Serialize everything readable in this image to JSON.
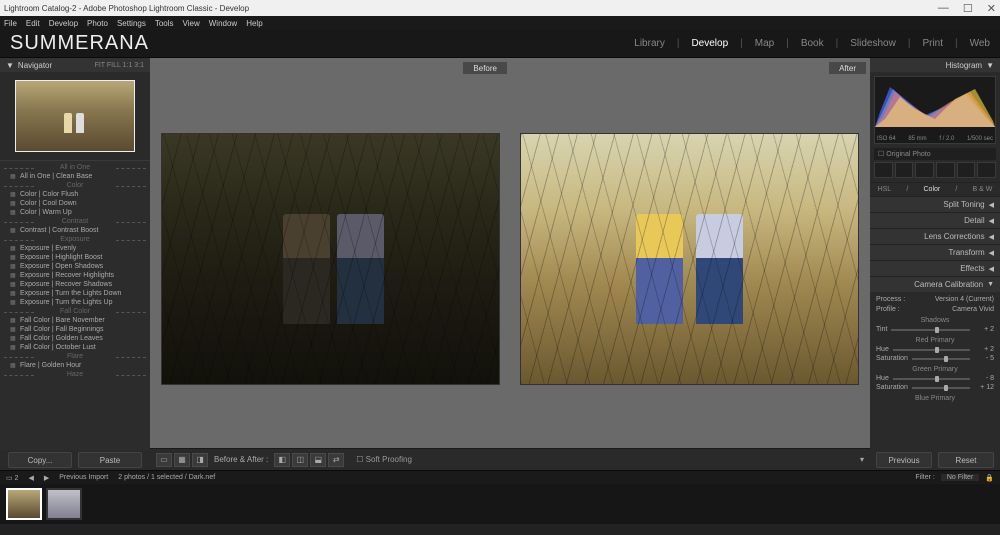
{
  "window": {
    "title": "Lightroom Catalog-2 - Adobe Photoshop Lightroom Classic - Develop"
  },
  "menu": [
    "File",
    "Edit",
    "Develop",
    "Photo",
    "Settings",
    "Tools",
    "View",
    "Window",
    "Help"
  ],
  "brand": "SUMMERANA",
  "modules": [
    "Library",
    "Develop",
    "Map",
    "Book",
    "Slideshow",
    "Print",
    "Web"
  ],
  "active_module": "Develop",
  "navigator": {
    "title": "Navigator",
    "opts": "FIT  FILL  1:1  3:1"
  },
  "presets": [
    {
      "type": "div",
      "label": "All in One"
    },
    {
      "type": "item",
      "label": "All in One | Clean Base"
    },
    {
      "type": "div",
      "label": "Color"
    },
    {
      "type": "item",
      "label": "Color | Color Flush"
    },
    {
      "type": "item",
      "label": "Color | Cool Down"
    },
    {
      "type": "item",
      "label": "Color | Warm Up"
    },
    {
      "type": "div",
      "label": "Contrast"
    },
    {
      "type": "item",
      "label": "Contrast | Contrast Boost"
    },
    {
      "type": "div",
      "label": "Exposure"
    },
    {
      "type": "item",
      "label": "Exposure | Evenly"
    },
    {
      "type": "item",
      "label": "Exposure | Highlight Boost"
    },
    {
      "type": "item",
      "label": "Exposure | Open Shadows"
    },
    {
      "type": "item",
      "label": "Exposure | Recover Highlights"
    },
    {
      "type": "item",
      "label": "Exposure | Recover Shadows"
    },
    {
      "type": "item",
      "label": "Exposure | Turn the Lights Down"
    },
    {
      "type": "item",
      "label": "Exposure | Turn the Lights Up"
    },
    {
      "type": "div",
      "label": "Fall Color"
    },
    {
      "type": "item",
      "label": "Fall Color | Bare November"
    },
    {
      "type": "item",
      "label": "Fall Color | Fall Beginnings"
    },
    {
      "type": "item",
      "label": "Fall Color | Golden Leaves"
    },
    {
      "type": "item",
      "label": "Fall Color | October Lust"
    },
    {
      "type": "div",
      "label": "Flare"
    },
    {
      "type": "item",
      "label": "Flare | Golden Hour"
    },
    {
      "type": "div",
      "label": "Haze"
    }
  ],
  "left_buttons": {
    "copy": "Copy...",
    "paste": "Paste"
  },
  "compare": {
    "before": "Before",
    "after": "After"
  },
  "toolbar": {
    "balabel": "Before & After :",
    "soft": "Soft Proofing"
  },
  "histogram": {
    "title": "Histogram",
    "meta": {
      "iso": "ISO 64",
      "focal": "85 mm",
      "aperture": "f / 2.0",
      "shutter": "1/500 sec"
    },
    "original": "Original Photo"
  },
  "right_panels": {
    "hsl": [
      "HSL",
      "Color",
      "B & W"
    ],
    "sections": [
      "Split Toning",
      "Detail",
      "Lens Corrections",
      "Transform",
      "Effects",
      "Camera Calibration"
    ]
  },
  "calibration": {
    "process_label": "Process :",
    "process_value": "Version 4 (Current)",
    "profile_label": "Profile :",
    "profile_value": "Camera Vivid",
    "shadows": {
      "label": "Shadows",
      "tint": "Tint",
      "tint_val": "+ 2"
    },
    "red": {
      "label": "Red Primary",
      "hue": "Hue",
      "hue_val": "+ 2",
      "sat": "Saturation",
      "sat_val": "- 5"
    },
    "green": {
      "label": "Green Primary",
      "hue": "Hue",
      "hue_val": "- 8",
      "sat": "Saturation",
      "sat_val": "+ 12"
    },
    "blue": {
      "label": "Blue Primary"
    }
  },
  "right_buttons": {
    "previous": "Previous",
    "reset": "Reset"
  },
  "secbar": {
    "prev_import": "Previous Import",
    "count": "2 photos / 1 selected / Dark.nef",
    "filter_label": "Filter :",
    "filter_value": "No Filter"
  }
}
